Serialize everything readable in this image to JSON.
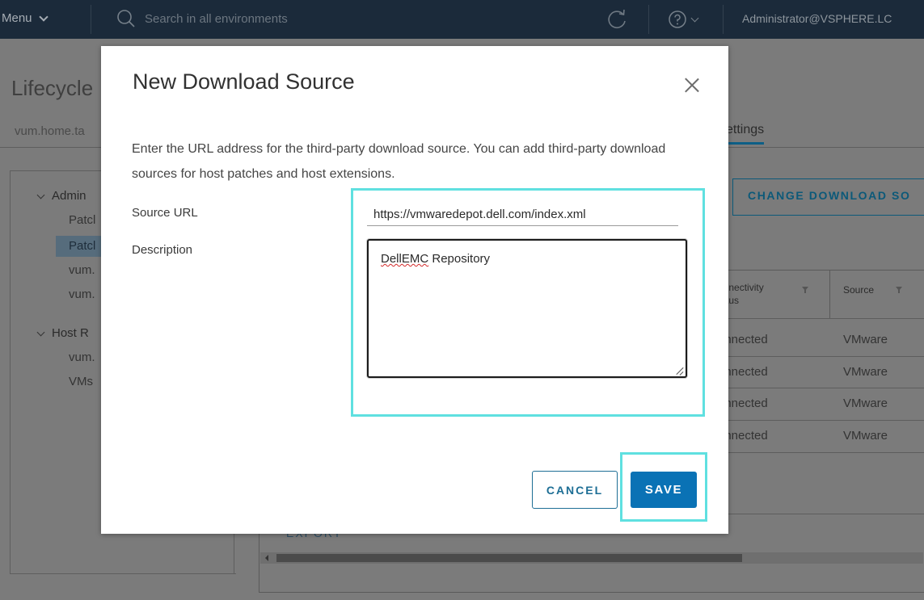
{
  "topbar": {
    "menu_label": "Menu",
    "search_placeholder": "Search in all environments",
    "user": "Administrator@VSPHERE.LC"
  },
  "page": {
    "title": "Lifecycle",
    "breadcrumb": "vum.home.ta",
    "settings_tab": "ettings",
    "tree": {
      "admin_group": "Admin",
      "admin_items": [
        "Patcl",
        "Patcl",
        "vum.",
        "vum."
      ],
      "host_group": "Host R",
      "host_items": [
        "vum.",
        "VMs"
      ]
    },
    "change_button": "CHANGE DOWNLOAD SO",
    "grid": {
      "headers": [
        {
          "label": "onnectivity\ntatus"
        },
        {
          "label": "Source"
        }
      ],
      "rows": [
        {
          "connectivity": "onnected",
          "source": "VMware"
        },
        {
          "connectivity": "onnected",
          "source": "VMware"
        },
        {
          "connectivity": "onnected",
          "source": "VMware"
        },
        {
          "connectivity": "onnected",
          "source": "VMware"
        }
      ]
    },
    "export_label": "EXPORT"
  },
  "modal": {
    "title": "New Download Source",
    "intro": "Enter the URL address for the third-party download source. You can add third-party download sources for host patches and host extensions.",
    "source_url_label": "Source URL",
    "source_url_value": "https://vmwaredepot.dell.com/index.xml",
    "description_label": "Description",
    "description_word_1": "DellEMC",
    "description_word_2": " Repository",
    "cancel_label": "CANCEL",
    "save_label": "SAVE"
  },
  "colors": {
    "topbar": "#1b2a3a",
    "overlay": "#7b7b7b",
    "highlight": "#5fe0e0",
    "primary": "#0a72b5"
  }
}
